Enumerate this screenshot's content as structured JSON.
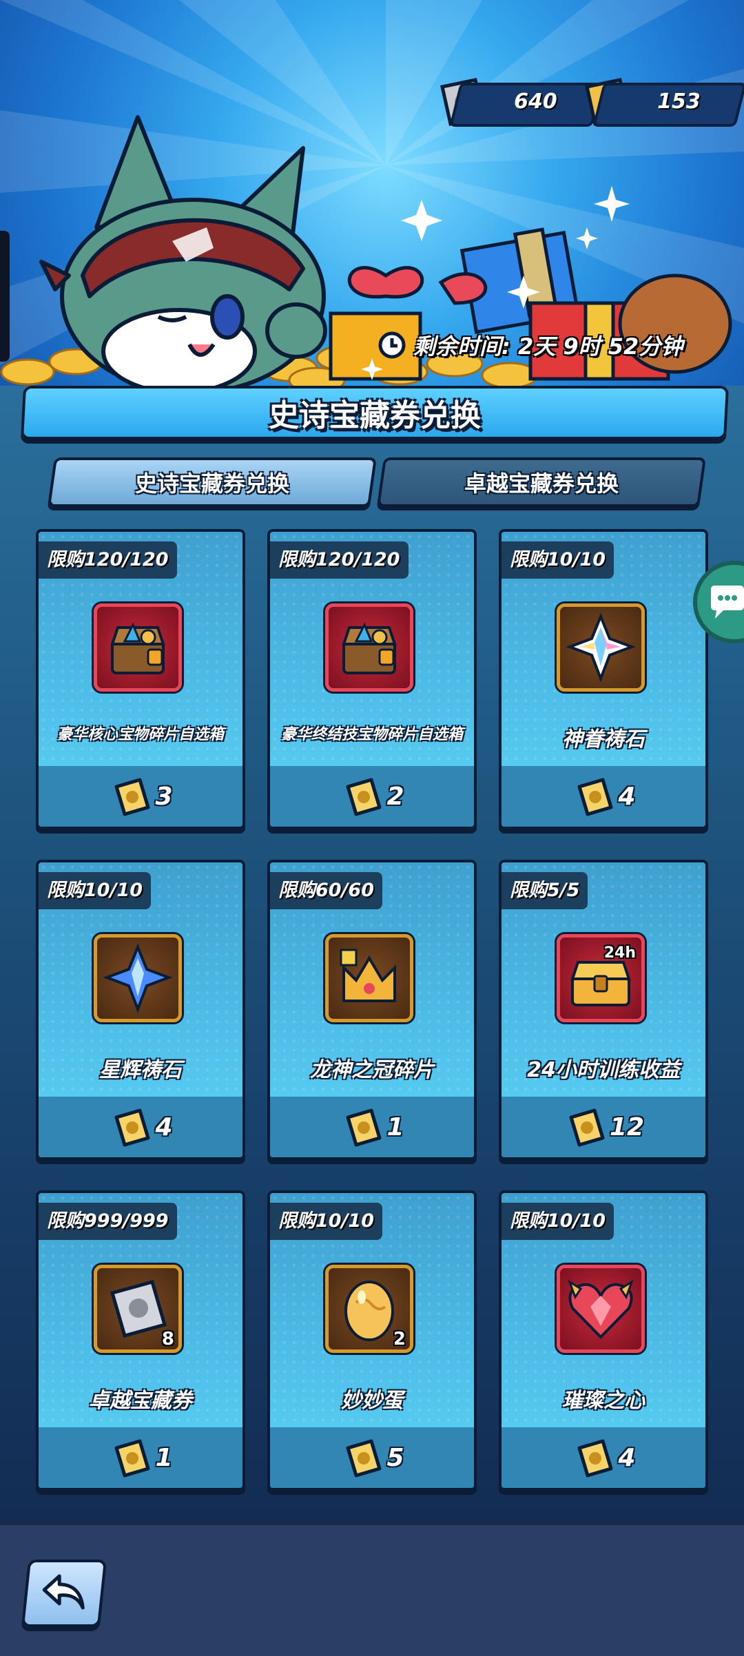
{
  "currencies": {
    "superior": {
      "icon": "silver-ticket-icon",
      "value": "640"
    },
    "epic": {
      "icon": "gold-ticket-icon",
      "value": "153"
    }
  },
  "timer": {
    "icon": "clock-icon",
    "text": "剩余时间: 2天 9时 52分钟"
  },
  "title": "史诗宝藏券兑换",
  "tabs": [
    {
      "label": "史诗宝藏券兑换",
      "active": true
    },
    {
      "label": "卓越宝藏券兑换",
      "active": false
    }
  ],
  "items": [
    {
      "limit": "限购120/120",
      "name": "豪华核心宝物碎片自选箱",
      "price": "3",
      "icon": "treasure-chest-icon",
      "frame": "red"
    },
    {
      "limit": "限购120/120",
      "name": "豪华终结技宝物碎片自选箱",
      "price": "2",
      "icon": "treasure-chest-icon",
      "frame": "red"
    },
    {
      "limit": "限购10/10",
      "name": "神眷祷石",
      "price": "4",
      "icon": "rainbow-crystal-icon",
      "frame": "gold"
    },
    {
      "limit": "限购10/10",
      "name": "星辉祷石",
      "price": "4",
      "icon": "blue-crystal-icon",
      "frame": "gold"
    },
    {
      "limit": "限购60/60",
      "name": "龙神之冠碎片",
      "price": "1",
      "icon": "crown-fragment-icon",
      "frame": "gold"
    },
    {
      "limit": "限购5/5",
      "name": "24小时训练收益",
      "price": "12",
      "icon": "gold-chest-icon",
      "frame": "red",
      "badge": "24h"
    },
    {
      "limit": "限购999/999",
      "name": "卓越宝藏券",
      "price": "1",
      "icon": "silver-ticket-icon",
      "frame": "gold",
      "qty": "8"
    },
    {
      "limit": "限购10/10",
      "name": "妙妙蛋",
      "price": "5",
      "icon": "golden-egg-icon",
      "frame": "gold",
      "qty": "2"
    },
    {
      "limit": "限购10/10",
      "name": "璀璨之心",
      "price": "4",
      "icon": "ruby-heart-icon",
      "frame": "red"
    }
  ],
  "price_icon": "gold-ticket-icon",
  "colors": {
    "accent": "#2aa9ee",
    "panel": "#1e5680",
    "card": "#4fc0ea",
    "gold": "#f2c04a"
  }
}
